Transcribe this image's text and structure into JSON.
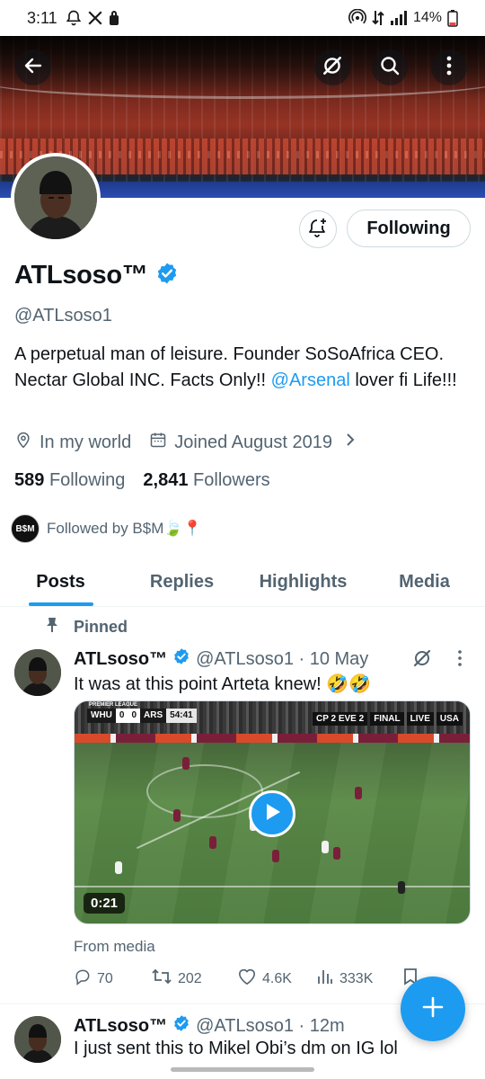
{
  "status_bar": {
    "time": "3:11",
    "battery": "14%",
    "icons": [
      "bell-off-icon",
      "x-logo-icon",
      "lock-icon",
      "hotspot-icon",
      "data-arrows-icon",
      "signal-icon",
      "battery-icon"
    ]
  },
  "banner": {
    "icons": [
      "back-arrow-icon",
      "grok-icon",
      "search-icon",
      "more-vertical-icon"
    ]
  },
  "profile": {
    "following_button": "Following",
    "display_name": "ATLsoso™",
    "handle": "@ATLsoso1",
    "bio_text": "A perpetual man of leisure. Founder SoSoAfrica CEO. Nectar Global INC. Facts Only!! ",
    "bio_mention": "@Arsenal",
    "bio_tail": " lover fi Life!!!",
    "location": "In my world",
    "joined": "Joined August 2019",
    "following_count": "589",
    "following_label": "Following",
    "followers_count": "2,841",
    "followers_label": "Followers",
    "followed_by": "Followed by B$M🍃📍",
    "followed_by_avatar_text": "B$M"
  },
  "tabs": [
    {
      "label": "Posts",
      "active": true
    },
    {
      "label": "Replies",
      "active": false
    },
    {
      "label": "Highlights",
      "active": false
    },
    {
      "label": "Media",
      "active": false
    }
  ],
  "posts": [
    {
      "pinned_label": "Pinned",
      "name": "ATLsoso™",
      "meta": "@ATLsoso1 · 10 May",
      "text": "It was at this point Arteta knew! 🤣🤣",
      "media": {
        "scorebug_label": "PREMIER LEAGUE",
        "home": "WHU",
        "score_home": "0",
        "score_away": "0",
        "away": "ARS",
        "clock": "54:41",
        "other_score": "CP  2  EVE  2",
        "other_label": "FINAL",
        "live": "LIVE",
        "broadcaster": "USA",
        "duration": "0:21"
      },
      "from_media": "From media",
      "replies": "70",
      "reposts": "202",
      "likes": "4.6K",
      "views": "333K"
    },
    {
      "name": "ATLsoso™",
      "meta": "@ATLsoso1 · 12m",
      "text": "I just sent this to Mikel Obi’s  dm on IG lol"
    }
  ],
  "colors": {
    "accent": "#1d9bf0",
    "text_primary": "#0f1419",
    "text_secondary": "#536471",
    "border": "#cfd9de"
  }
}
